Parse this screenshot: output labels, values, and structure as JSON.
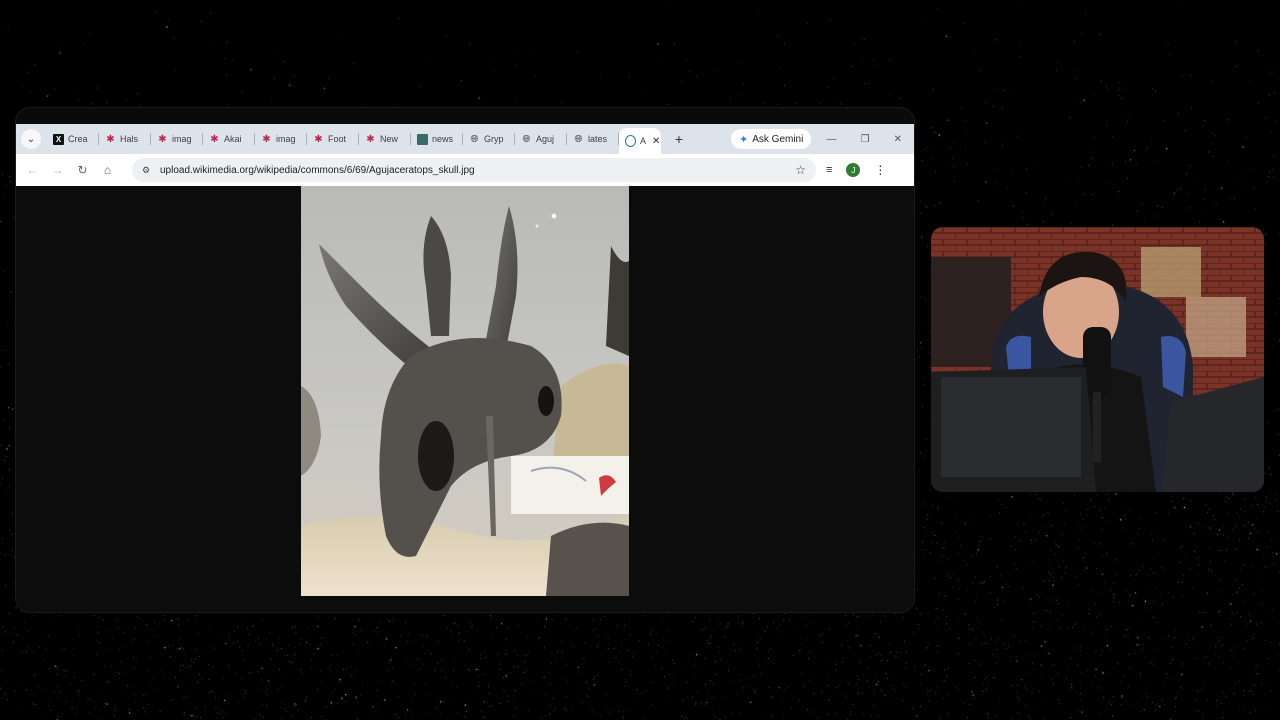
{
  "browser": {
    "tabs": [
      {
        "icon": "x-logo-icon",
        "title": "Crea"
      },
      {
        "icon": "star-logo-icon",
        "title": "Hals"
      },
      {
        "icon": "star-logo-icon",
        "title": "imag"
      },
      {
        "icon": "star-logo-icon",
        "title": "Akai"
      },
      {
        "icon": "star-logo-icon",
        "title": "imag"
      },
      {
        "icon": "star-logo-icon",
        "title": "Foot"
      },
      {
        "icon": "star-logo-icon",
        "title": "New"
      },
      {
        "icon": "image-icon",
        "title": "news"
      },
      {
        "icon": "globe-icon",
        "title": "Gryp"
      },
      {
        "icon": "globe-icon",
        "title": "Aguj"
      },
      {
        "icon": "globe-icon",
        "title": "lates"
      },
      {
        "icon": "wikipedia-icon",
        "title": "A",
        "active": true
      }
    ],
    "ask_gemini_label": "Ask Gemini",
    "url": "upload.wikimedia.org/wikipedia/commons/6/69/Agujaceratops_skull.jpg",
    "profile_initial": "J"
  },
  "colors": {
    "tabstrip": "#dde3ea",
    "toolbar": "#ffffff",
    "viewport": "#0c0c0c",
    "profile": "#2e7d32"
  }
}
